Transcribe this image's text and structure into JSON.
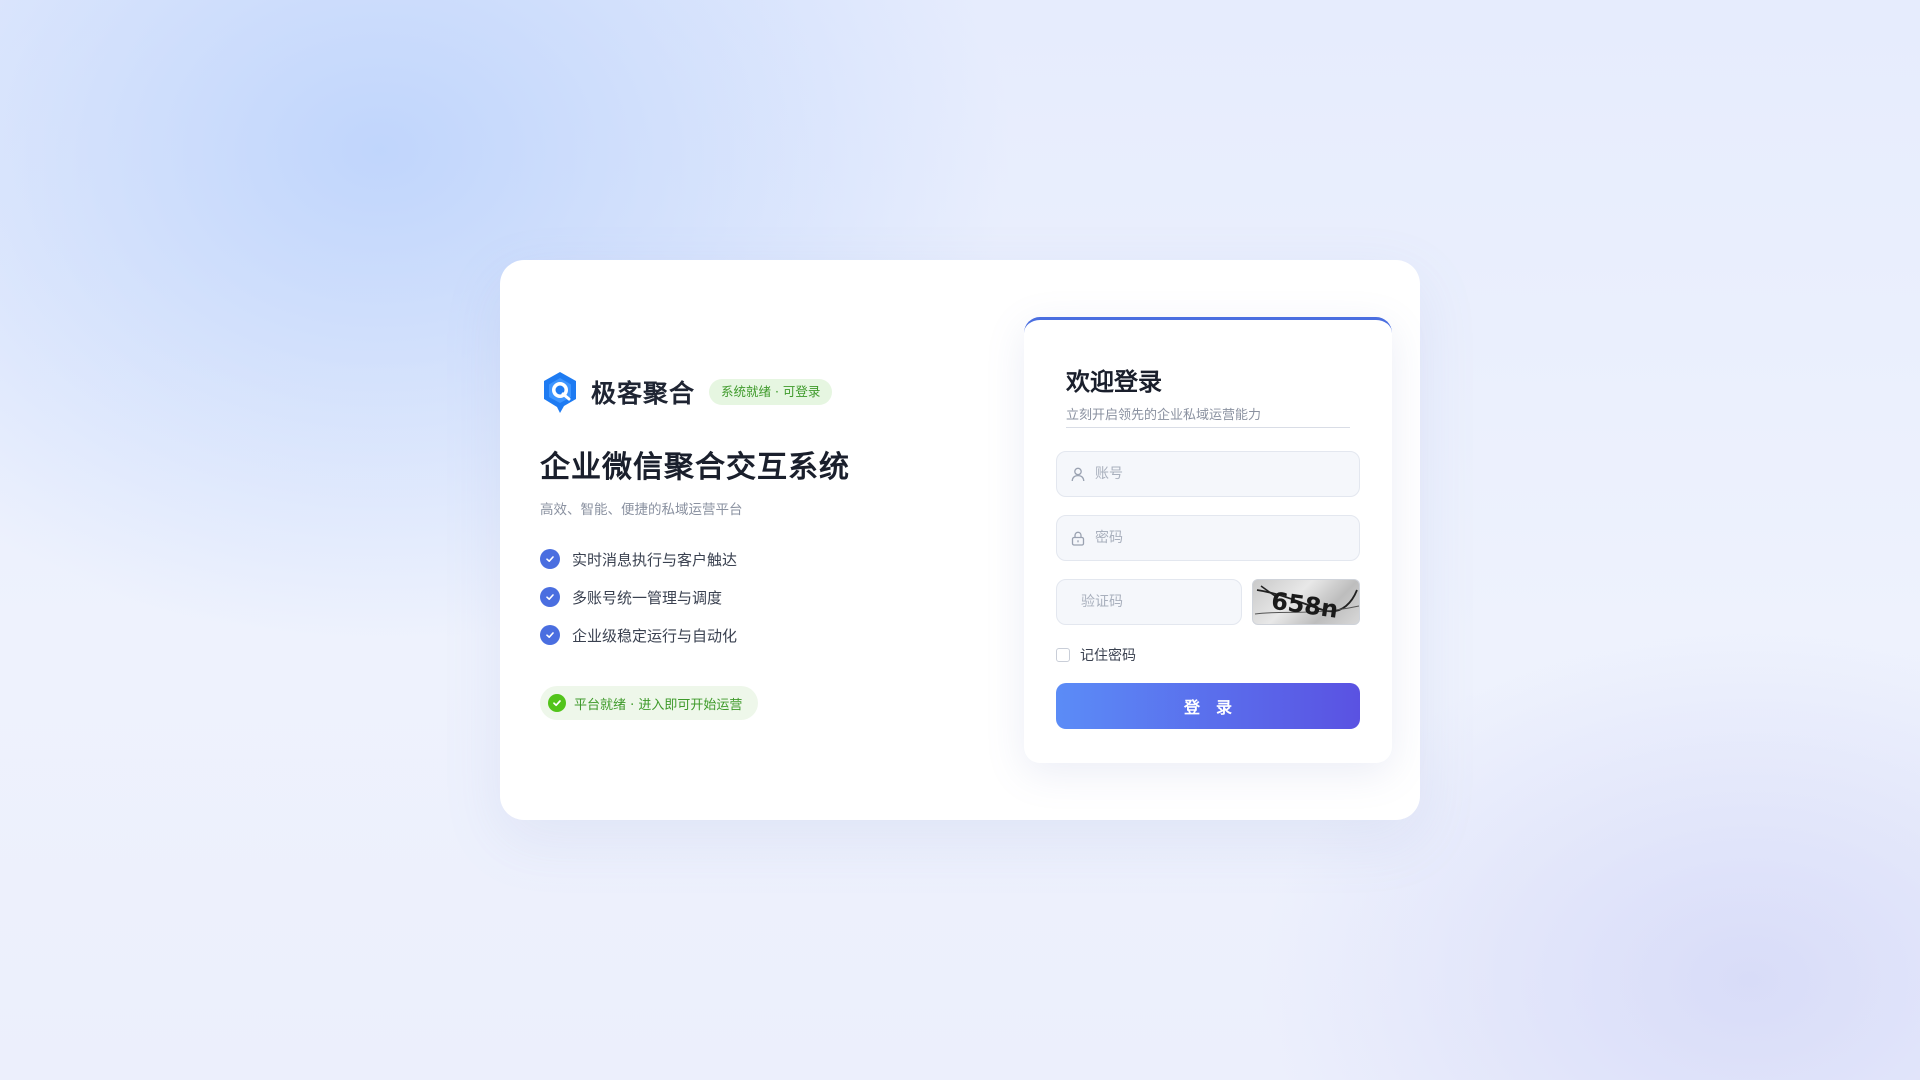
{
  "brand": {
    "name": "极客聚合",
    "status_badge": "系统就绪 · 可登录",
    "primary_color": "#1e7bf2"
  },
  "hero": {
    "title": "企业微信聚合交互系统",
    "subtitle": "高效、智能、便捷的私域运营平台",
    "features": [
      "实时消息执行与客户触达",
      "多账号统一管理与调度",
      "企业级稳定运行与自动化"
    ],
    "ready_text": "平台就绪 · 进入即可开始运营"
  },
  "login": {
    "title": "欢迎登录",
    "subtitle": "立刻开启领先的企业私域运营能力",
    "username_placeholder": "账号",
    "password_placeholder": "密码",
    "captcha_placeholder": "验证码",
    "captcha_text": "658n",
    "remember_label": "记住密码",
    "submit_label": "登录",
    "accent_color": "#4a6ee0"
  }
}
